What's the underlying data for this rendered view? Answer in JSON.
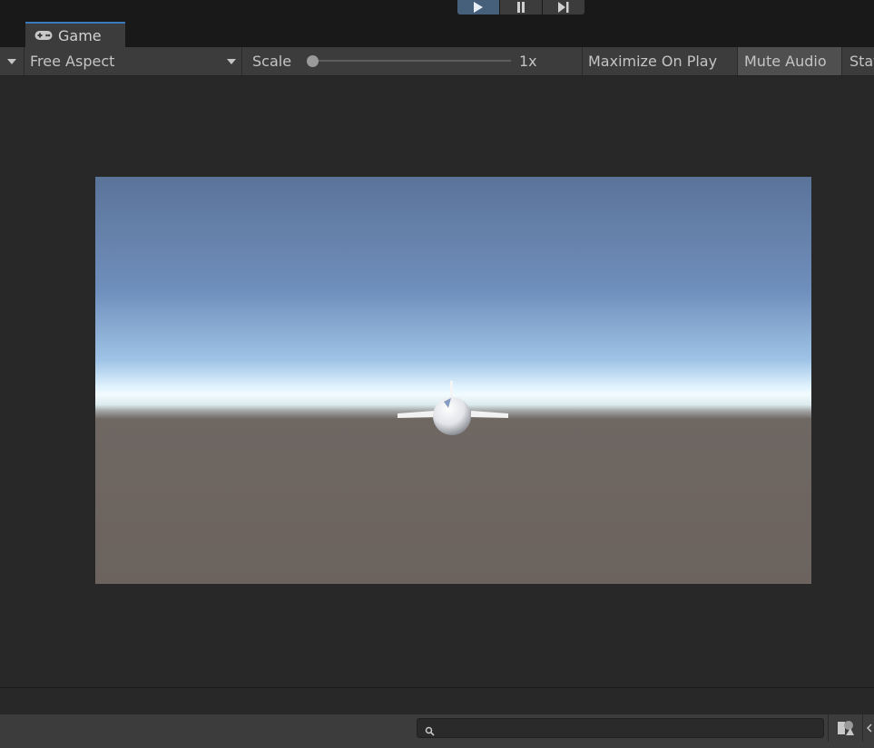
{
  "play_toolbar": {
    "play_icon": "play-icon",
    "pause_icon": "pause-icon",
    "step_icon": "step-icon"
  },
  "tab": {
    "icon": "gamepad-icon",
    "label": "Game"
  },
  "toolbar": {
    "aspect_value": "Free Aspect",
    "scale_label": "Scale",
    "scale_value": "1x",
    "scale_level": 0,
    "maximize_label": "Maximize On Play",
    "mute_label": "Mute Audio",
    "stats_label": "Stats"
  },
  "colors": {
    "accent": "#3a79bb",
    "sky_top": "#5b7399",
    "horizon": "#f2fbff",
    "ground": "#6c635e"
  },
  "bottom": {
    "search_placeholder": "",
    "search_icon": "search-icon",
    "scene_filter_icon": "shapes-icon"
  }
}
